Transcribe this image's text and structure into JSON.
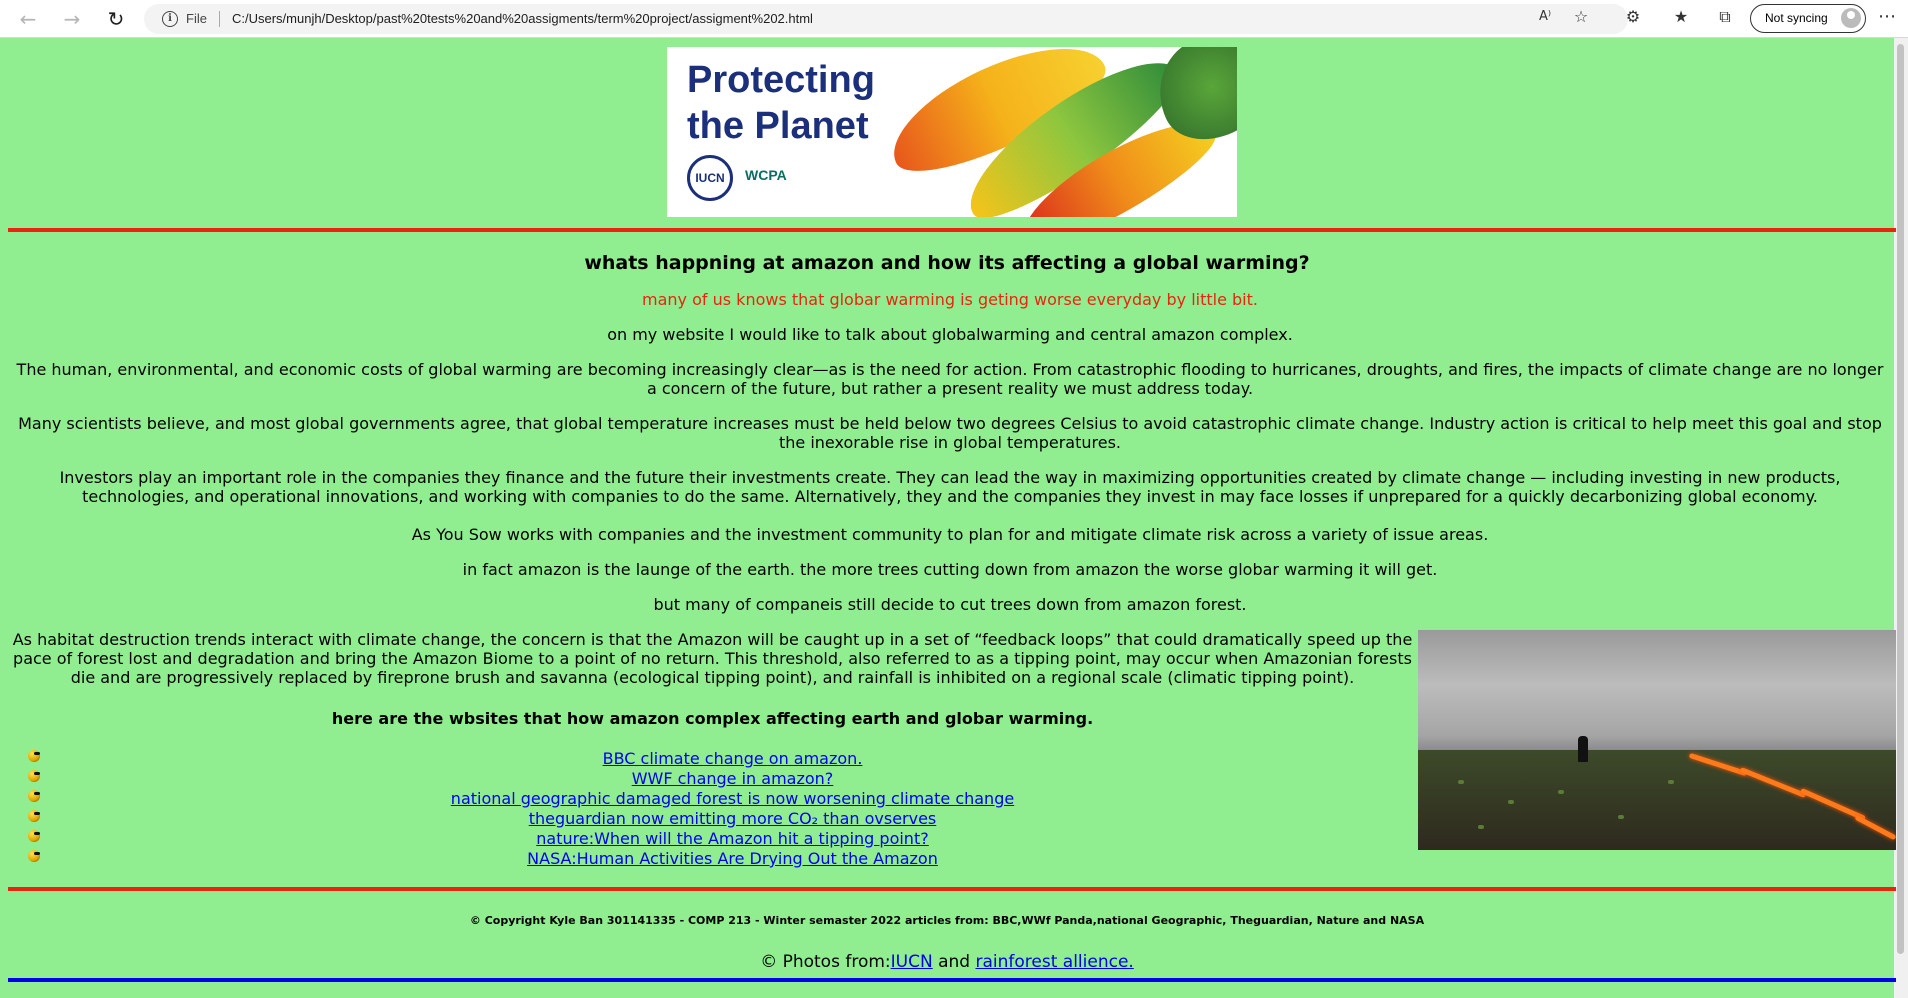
{
  "browser": {
    "file_label": "File",
    "url": "C:/Users/munjh/Desktop/past%20tests%20and%20assigments/term%20project/assigment%202.html",
    "sync_label": "Not syncing",
    "icons": [
      "back-arrow-icon",
      "forward-arrow-icon",
      "refresh-icon",
      "info-icon",
      "read-aloud-icon",
      "add-favorite-icon",
      "extensions-icon",
      "favorites-icon",
      "collections-icon",
      "profile-icon",
      "more-menu-icon"
    ]
  },
  "banner": {
    "title_line1": "Protecting",
    "title_line2": "the Planet",
    "logo1": "IUCN",
    "logo2": "WCPA"
  },
  "article": {
    "heading": "whats happning at amazon and how its affecting a global warming?",
    "intro_red": "many of us knows that globar warming is geting worse everyday by little bit.",
    "p1": "on my website I would like to talk about globalwarming and central amazon complex.",
    "p2": "The human, environmental, and economic costs of global warming are becoming increasingly clear—as is the need for action. From catastrophic flooding to hurricanes, droughts, and fires, the impacts of climate change are no longer a concern of the future, but rather a present reality we must address today.",
    "p3": "Many scientists believe, and most global governments agree, that global temperature increases must be held below two degrees Celsius to avoid catastrophic climate change. Industry action is critical to help meet this goal and stop the inexorable rise in global temperatures.",
    "p4": "Investors play an important role in the companies they finance and the future their investments create. They can lead the way in maximizing opportunities created by climate change — including investing in new products, technologies, and operational innovations, and working with companies to do the same. Alternatively, they and the companies they invest in may face losses if unprepared for a quickly decarbonizing global economy.",
    "p5": "As You Sow works with companies and the investment community to plan for and mitigate climate risk across a variety of issue areas.",
    "p6": "in fact amazon is the launge of the earth. the more trees cutting down from amazon the worse globar warming it will get.",
    "p7": "but many of companeis still decide to cut trees down from amazon forest.",
    "p8": "As habitat destruction trends interact with climate change, the concern is that the Amazon will be caught up in a set of “feedback loops” that could dramatically speed up the pace of forest lost and degradation and bring the Amazon Biome to a point of no return. This threshold, also referred to as a tipping point, may occur when Amazonian forests die and are progressively replaced by fireprone brush and savanna (ecological tipping point), and rainfall is inhibited on a regional scale (climatic tipping point).",
    "links_heading": "here are the wbsites that how amazon complex affecting earth and globar warming.",
    "links": [
      "BBC climate change on amazon.",
      "WWF change in amazon?",
      "national geographic damaged forest is now worsening climate change",
      "theguardian now emitting more CO₂ than ovserves",
      "nature:When will the Amazon hit a tipping point?",
      "NASA:Human Activities Are Drying Out the Amazon"
    ]
  },
  "footer": {
    "copyright": "©  Copyright Kyle Ban 301141335 - COMP 213 - Winter semaster 2022 articles from: BBC,WWf Panda,national Geographic, Theguardian, Nature and NASA",
    "photos_prefix": "©   Photos from:",
    "photos_link1": "IUCN",
    "photos_and": " and ",
    "photos_link2": "rainforest allience."
  }
}
